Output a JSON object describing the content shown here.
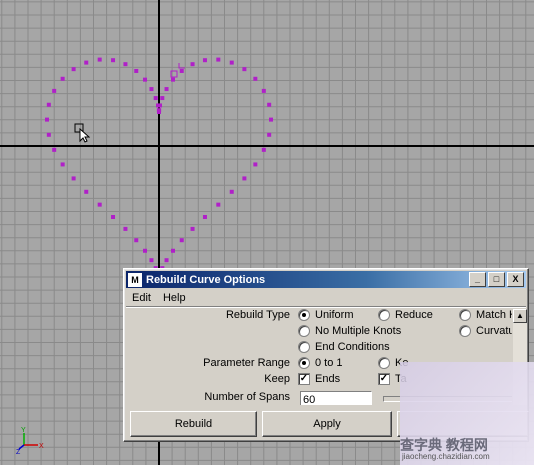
{
  "dialog": {
    "title": "Rebuild Curve Options",
    "window_buttons": {
      "minimize": "_",
      "maximize": "□",
      "close": "X"
    },
    "menu": [
      "Edit",
      "Help"
    ],
    "rebuild_type": {
      "label": "Rebuild Type",
      "options": [
        "Uniform",
        "Reduce",
        "Match Kn",
        "No Multiple Knots",
        "Curvature",
        "End Conditions"
      ],
      "selected": "Uniform"
    },
    "parameter_range": {
      "label": "Parameter Range",
      "options": [
        "0 to 1",
        "Ke"
      ],
      "selected": "0 to 1"
    },
    "keep": {
      "label": "Keep",
      "options": [
        "Ends",
        "Ta"
      ],
      "ends_checked": true,
      "tangents_checked": true
    },
    "number_of_spans": {
      "label": "Number of Spans",
      "value": "60"
    },
    "buttons": {
      "rebuild": "Rebuild",
      "apply": "Apply"
    }
  },
  "viewport": {
    "axis_labels": {
      "y": "Y",
      "z": "Z",
      "x": "X"
    },
    "curve_color": "#b020c8",
    "axis_color": "#000000",
    "grid_color": "#8a8a8a"
  },
  "watermark": {
    "text": "查字典 教程网",
    "url": "jiaocheng.chazidian.com"
  }
}
